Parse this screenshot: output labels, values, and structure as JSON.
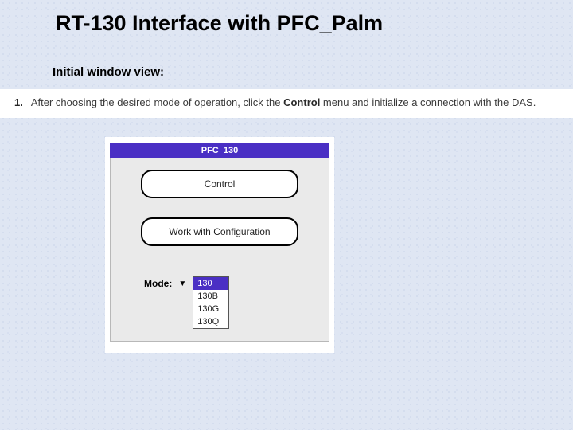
{
  "title": "RT-130 Interface with PFC_Palm",
  "subtitle": "Initial window view:",
  "instruction": {
    "num": "1.",
    "before": "After choosing the desired mode of operation, click the ",
    "bold": "Control",
    "after": " menu and initialize a connection with the DAS."
  },
  "pfc": {
    "windowTitle": "PFC_130",
    "controlBtn": "Control",
    "configBtn": "Work with Configuration",
    "modeLabel": "Mode:",
    "modeOptions": [
      "130",
      "130B",
      "130G",
      "130Q"
    ],
    "modeSelectedIndex": 0
  }
}
